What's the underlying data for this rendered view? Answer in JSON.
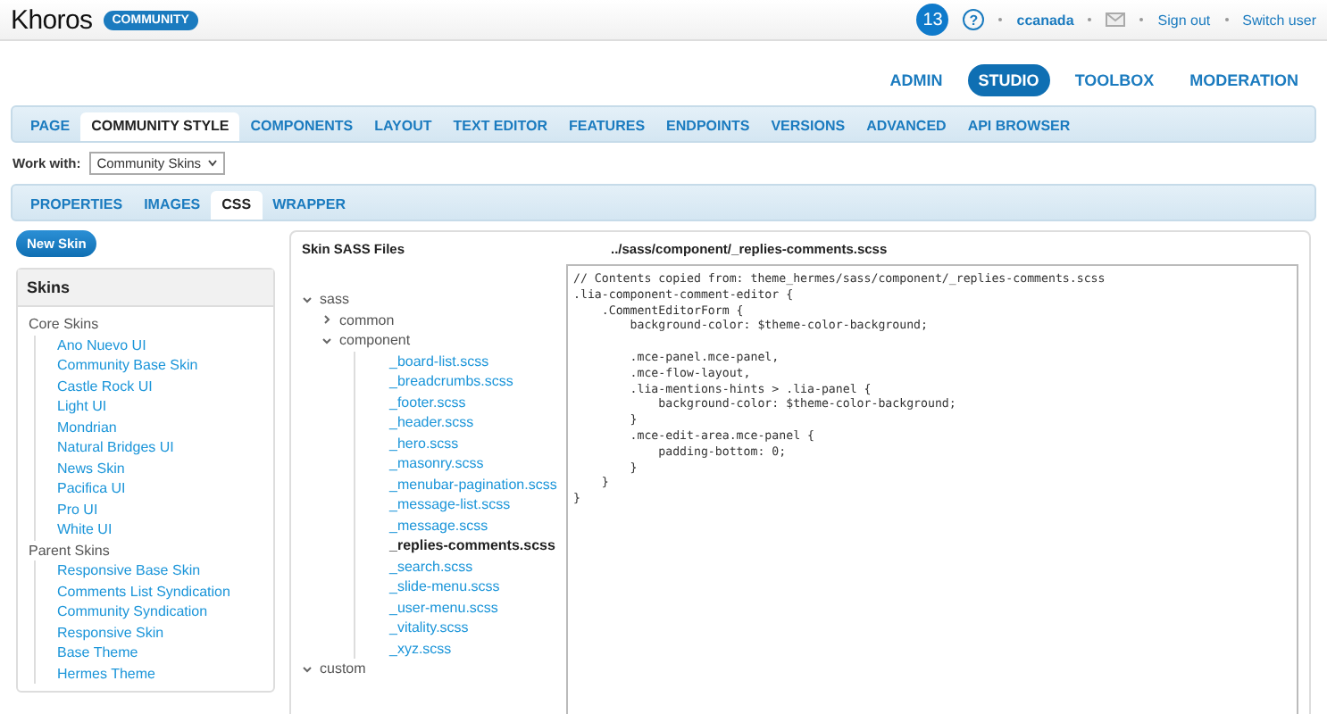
{
  "header": {
    "logo": "Khoros",
    "badge": "COMMUNITY",
    "notifications": "13",
    "help": "?",
    "user": "ccanada",
    "links": [
      "Sign out",
      "Switch user"
    ]
  },
  "admin_nav": [
    {
      "label": "ADMIN",
      "selected": false
    },
    {
      "label": "STUDIO",
      "selected": true
    },
    {
      "label": "TOOLBOX",
      "selected": false
    },
    {
      "label": "MODERATION",
      "selected": false
    }
  ],
  "tabs": [
    {
      "label": "PAGE",
      "selected": false
    },
    {
      "label": "COMMUNITY STYLE",
      "selected": true
    },
    {
      "label": "COMPONENTS",
      "selected": false
    },
    {
      "label": "LAYOUT",
      "selected": false
    },
    {
      "label": "TEXT EDITOR",
      "selected": false
    },
    {
      "label": "FEATURES",
      "selected": false
    },
    {
      "label": "ENDPOINTS",
      "selected": false
    },
    {
      "label": "VERSIONS",
      "selected": false
    },
    {
      "label": "ADVANCED",
      "selected": false
    },
    {
      "label": "API BROWSER",
      "selected": false
    }
  ],
  "work_with": {
    "label": "Work with:",
    "value": "Community Skins"
  },
  "subtabs": [
    {
      "label": "PROPERTIES",
      "selected": false
    },
    {
      "label": "IMAGES",
      "selected": false
    },
    {
      "label": "CSS",
      "selected": true
    },
    {
      "label": "WRAPPER",
      "selected": false
    }
  ],
  "new_skin_button": "New Skin",
  "skins": {
    "title": "Skins",
    "groups": [
      {
        "label": "Core Skins",
        "items": [
          "Ano Nuevo UI",
          "Community Base Skin",
          "Castle Rock UI",
          "Light UI",
          "Mondrian",
          "Natural Bridges UI",
          "News Skin",
          "Pacifica UI",
          "Pro UI",
          "White UI"
        ]
      },
      {
        "label": "Parent Skins",
        "items": [
          "Responsive Base Skin",
          "Comments List Syndication",
          "Community Syndication",
          "Responsive Skin",
          "Base Theme",
          "Hermes Theme"
        ]
      }
    ]
  },
  "files": {
    "title": "Skin SASS Files",
    "path": "../sass/component/_replies-comments.scss",
    "tree": [
      {
        "name": "sass",
        "expanded": true,
        "children": [
          {
            "name": "common",
            "expanded": false
          },
          {
            "name": "component",
            "expanded": true,
            "children": [
              {
                "name": "_board-list.scss",
                "selected": false
              },
              {
                "name": "_breadcrumbs.scss",
                "selected": false
              },
              {
                "name": "_footer.scss",
                "selected": false
              },
              {
                "name": "_header.scss",
                "selected": false
              },
              {
                "name": "_hero.scss",
                "selected": false
              },
              {
                "name": "_masonry.scss",
                "selected": false
              },
              {
                "name": "_menubar-pagination.scss",
                "selected": false
              },
              {
                "name": "_message-list.scss",
                "selected": false
              },
              {
                "name": "_message.scss",
                "selected": false
              },
              {
                "name": "_replies-comments.scss",
                "selected": true
              },
              {
                "name": "_search.scss",
                "selected": false
              },
              {
                "name": "_slide-menu.scss",
                "selected": false
              },
              {
                "name": "_user-menu.scss",
                "selected": false
              },
              {
                "name": "_vitality.scss",
                "selected": false
              },
              {
                "name": "_xyz.scss",
                "selected": false
              }
            ]
          }
        ]
      },
      {
        "name": "custom",
        "expanded": true
      }
    ]
  },
  "code": "// Contents copied from: theme_hermes/sass/component/_replies-comments.scss\n.lia-component-comment-editor {\n    .CommentEditorForm {\n        background-color: $theme-color-background;\n\n        .mce-panel.mce-panel,\n        .mce-flow-layout,\n        .lia-mentions-hints > .lia-panel {\n            background-color: $theme-color-background;\n        }\n        .mce-edit-area.mce-panel {\n            padding-bottom: 0;\n        }\n    }\n}"
}
